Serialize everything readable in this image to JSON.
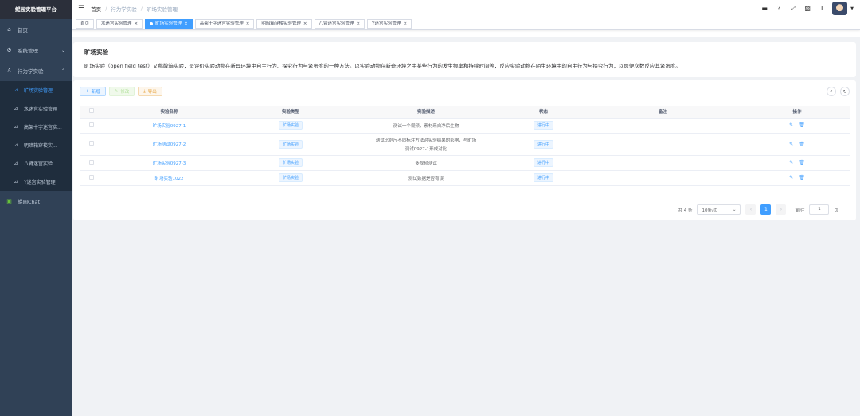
{
  "sidebar": {
    "logo": "鲲园实验管理平台",
    "items": [
      {
        "label": "首页"
      },
      {
        "label": "系统管理"
      },
      {
        "label": "行为学实验"
      }
    ],
    "sub": [
      {
        "label": "旷场实验管理"
      },
      {
        "label": "水迷宫实验管理"
      },
      {
        "label": "高架十字迷宫实..."
      },
      {
        "label": "明暗箱穿梭实..."
      },
      {
        "label": "八臂迷宫实验..."
      },
      {
        "label": "Y迷宫实验管理"
      }
    ],
    "chat": "鲲园Chat"
  },
  "breadcrumb": [
    "首页",
    "行为学实验",
    "旷场实验管理"
  ],
  "tags": [
    {
      "label": "首页"
    },
    {
      "label": "水迷宫实验管理"
    },
    {
      "label": "旷场实验管理"
    },
    {
      "label": "高架十字迷宫实验管理"
    },
    {
      "label": "明暗箱穿梭实验管理"
    },
    {
      "label": "八臂迷宫实验管理"
    },
    {
      "label": "Y迷宫实验管理"
    }
  ],
  "intro": {
    "title": "旷场实验",
    "desc": "旷场实验（open field test）又称敞箱实验，是评价实验动物在新异环境中自主行为、探究行为与紧张度的一种方法。以实验动物在新奇环境之中某些行为的发生频率和持续时间等，反应实验动物在陌生环境中的自主行为与探究行为，以尿便次数反应其紧张度。"
  },
  "toolbar": {
    "add": "新增",
    "edit": "修改",
    "export": "导出"
  },
  "table": {
    "headers": [
      "实验名称",
      "实验类型",
      "实验描述",
      "状态",
      "备注",
      "操作"
    ],
    "rows": [
      {
        "name": "旷场实验0927-1",
        "type": "旷场实验",
        "desc1": "测试一个视频，素材来自净后生物",
        "desc2": "",
        "status": "进行中"
      },
      {
        "name": "旷场测试0927-2",
        "type": "旷场实验",
        "desc1": "测试比例尺不同标注方法对实验结果的影响，与旷场",
        "desc2": "测试0927-1形成对比",
        "status": "进行中"
      },
      {
        "name": "旷场实验0927-3",
        "type": "旷场实验",
        "desc1": "多视频测试",
        "desc2": "",
        "status": "进行中"
      },
      {
        "name": "旷场实验1022",
        "type": "旷场实验",
        "desc1": "测试数据是否有误",
        "desc2": "",
        "status": "进行中"
      }
    ]
  },
  "pagination": {
    "total": "共 4 条",
    "size": "10条/页",
    "page": "1",
    "goto": "前往",
    "jump": "1",
    "unit": "页"
  }
}
